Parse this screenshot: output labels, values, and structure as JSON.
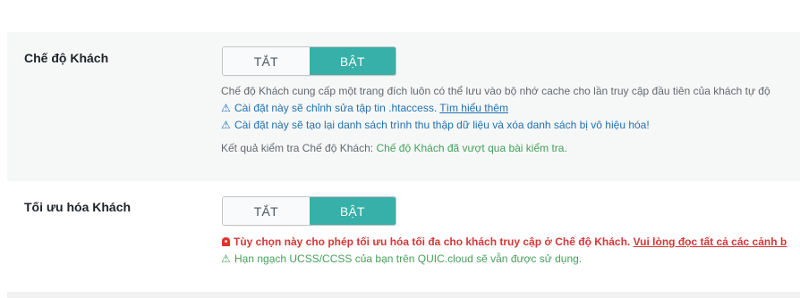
{
  "guest_mode": {
    "label": "Chế độ Khách",
    "toggle": {
      "off_label": "TẮT",
      "on_label": "BẬT",
      "selected": "BẬT"
    },
    "description": "Chế độ Khách cung cấp một trang đích luôn có thể lưu vào bộ nhớ cache cho lần truy cập đầu tiên của khách tự độ",
    "warning_htaccess": "Cài đặt này sẽ chỉnh sửa tập tin .htaccess.",
    "learn_more_link": "Tìm hiểu thêm",
    "warning_crawler": "Cài đặt này sẽ tạo lại danh sách trình thu thập dữ liệu và xóa danh sách bị vô hiệu hóa!",
    "test_result_label": "Kết quả kiểm tra Chế độ Khách:",
    "test_result_value": "Chế độ Khách đã vượt qua bài kiểm tra."
  },
  "guest_optimization": {
    "label": "Tối ưu hóa Khách",
    "toggle": {
      "off_label": "TẮT",
      "on_label": "BẬT",
      "selected": "BẬT"
    },
    "danger_text": "Tùy chọn này cho phép tối ưu hóa tối đa cho khách truy cập ở Chế độ Khách.",
    "danger_link": "Vui lòng đọc tất cả các cảnh b",
    "quota_note": "Hạn ngạch UCSS/CCSS của bạn trên QUIC.cloud sẽ vẫn được sử dụng."
  },
  "icons": {
    "warning": "warning-triangle-icon",
    "siren": "siren-icon"
  },
  "colors": {
    "toggle_on": "#36b0a8",
    "link_blue": "#2271b1",
    "success_green": "#46a05a",
    "danger_red": "#d63638",
    "row_background": "#f6f7f7"
  }
}
